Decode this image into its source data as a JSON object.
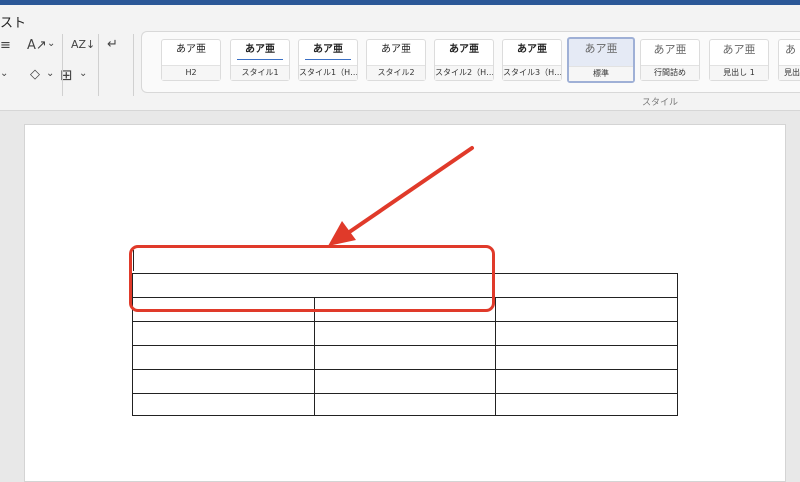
{
  "ribbon": {
    "tab_label": "スト",
    "group_label": "スタイル",
    "tools_row1": [
      "≡",
      "A↗",
      "⌄",
      "AZ↓",
      "↵"
    ],
    "tools_row2": [
      "⌄",
      "◇",
      "⌄",
      "⊞",
      "⌄"
    ],
    "styles": [
      {
        "preview": "あア亜",
        "name": "H2",
        "variant": "normal"
      },
      {
        "preview": "あア亜",
        "name": "スタイル1",
        "variant": "bold-underline"
      },
      {
        "preview": "あア亜",
        "name": "スタイル1（H…",
        "variant": "bold-underline"
      },
      {
        "preview": "あア亜",
        "name": "スタイル2",
        "variant": "normal"
      },
      {
        "preview": "あア亜",
        "name": "スタイル2（H…",
        "variant": "bold"
      },
      {
        "preview": "あア亜",
        "name": "スタイル3（H…",
        "variant": "bold"
      },
      {
        "preview": "あア亜",
        "name": "標準",
        "variant": "selected"
      },
      {
        "preview": "あア亜",
        "name": "行間詰め",
        "variant": "light"
      },
      {
        "preview": "あア亜",
        "name": "見出し 1",
        "variant": "light"
      },
      {
        "preview": "あ",
        "name": "見出",
        "variant": "light"
      }
    ]
  },
  "annotation": {
    "color": "#e03a2a"
  }
}
